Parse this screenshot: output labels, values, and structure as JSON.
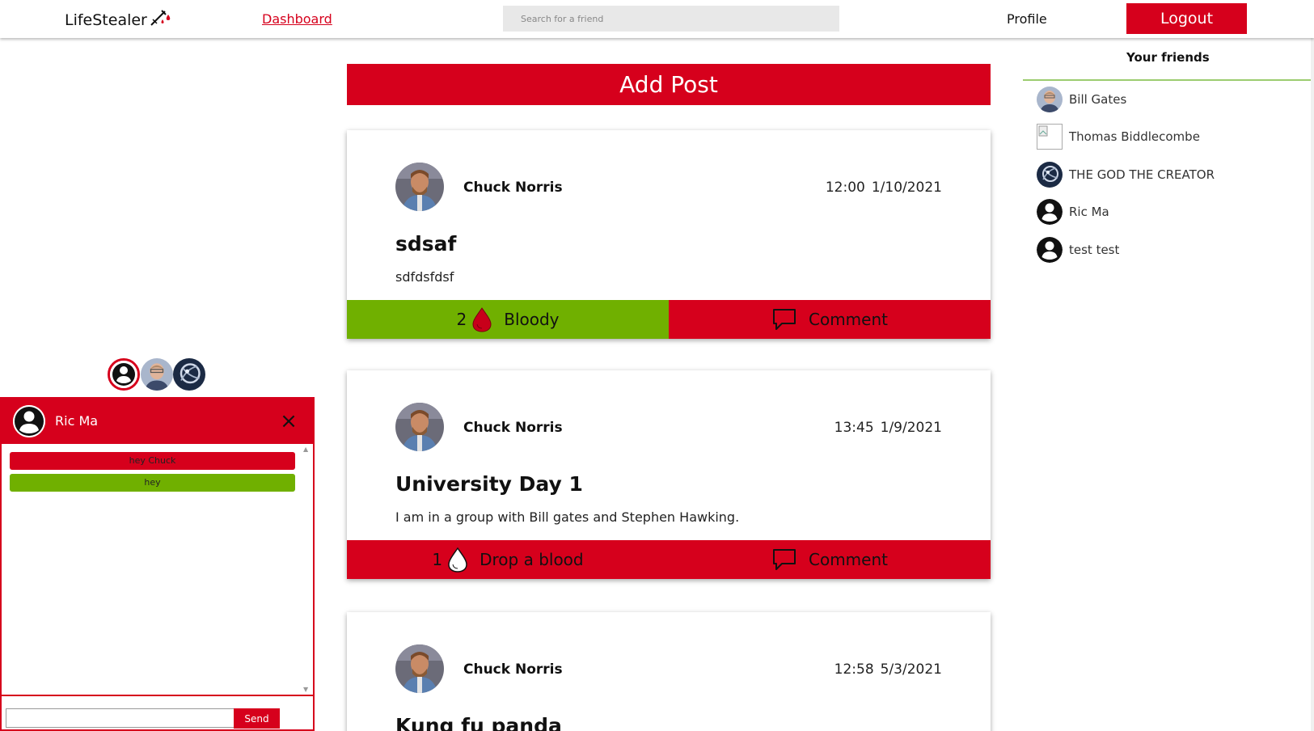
{
  "nav": {
    "logo": "LifeStealer",
    "dashboard": "Dashboard",
    "search_placeholder": "Search for a friend",
    "profile": "Profile",
    "logout": "Logout"
  },
  "feed": {
    "add_post": "Add Post",
    "posts": [
      {
        "author": "Chuck Norris",
        "time": "12:00",
        "date": "1/10/2021",
        "title": "sdsaf",
        "body": "sdfdsfdsf",
        "blood_count": "2",
        "blood_label": "Bloody",
        "blooded": true,
        "comment_label": "Comment"
      },
      {
        "author": "Chuck Norris",
        "time": "13:45",
        "date": "1/9/2021",
        "title": "University Day 1",
        "body": "I am in a group with Bill gates and Stephen Hawking.",
        "blood_count": "1",
        "blood_label": "Drop a blood",
        "blooded": false,
        "comment_label": "Comment"
      },
      {
        "author": "Chuck Norris",
        "time": "12:58",
        "date": "5/3/2021",
        "title": "Kung fu panda",
        "body": "",
        "blood_count": "",
        "blood_label": "",
        "blooded": false,
        "comment_label": ""
      }
    ]
  },
  "friends": {
    "title": "Your friends",
    "list": [
      {
        "name": "Bill Gates",
        "avatar": "bill-gates-photo"
      },
      {
        "name": "Thomas Biddlecombe",
        "avatar": "broken-image"
      },
      {
        "name": "THE GOD THE CREATOR",
        "avatar": "dark-art-photo"
      },
      {
        "name": "Ric Ma",
        "avatar": "default-user-icon"
      },
      {
        "name": "test test",
        "avatar": "default-user-icon"
      }
    ]
  },
  "chat": {
    "name": "Ric Ma",
    "close": "×",
    "messages": [
      {
        "text": "hey Chuck",
        "from": "them"
      },
      {
        "text": "hey",
        "from": "me"
      }
    ],
    "input_value": "",
    "send": "Send"
  },
  "colors": {
    "brand_red": "#d6001c",
    "green": "#70b000",
    "divider_green": "#9ccc70"
  }
}
